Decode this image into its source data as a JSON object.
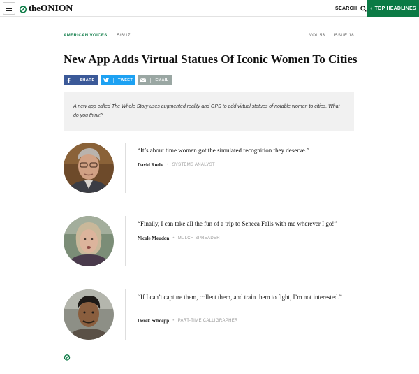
{
  "header": {
    "logo_text_the": "the",
    "logo_text_onion": "ONION",
    "search_label": "SEARCH",
    "top_headlines_label": "TOP HEADLINES"
  },
  "article": {
    "section": "AMERICAN VOICES",
    "date": "5/6/17",
    "volume": "VOL 53",
    "issue": "ISSUE 18",
    "title": "New App Adds Virtual Statues Of Iconic Women To Cities",
    "share": {
      "facebook": "SHARE",
      "twitter": "TWEET",
      "email": "EMAIL"
    },
    "summary": "A new app called The Whole Story uses augmented reality and GPS to add virtual statues of notable women to cities. What do you think?"
  },
  "responses": [
    {
      "quote": "“It’s about time women got the simulated recognition they deserve.”",
      "name": "David Rodie",
      "title": "SYSTEMS ANALYST"
    },
    {
      "quote": "“Finally, I can take all the fun of a trip to Seneca Falls with me wherever I go!”",
      "name": "Nicole Meudon",
      "title": "MULCH SPREADER"
    },
    {
      "quote": "“If I can’t capture them, collect them, and train them to fight, I’m not interested.”",
      "name": "Derek Schoepp",
      "title": "PART-TIME CALLIGRAPHER"
    }
  ],
  "colors": {
    "brand_green": "#0b7a45",
    "facebook": "#3b5998",
    "twitter": "#1da1f2",
    "email": "#9aa7a3"
  },
  "icons": [
    "menu-icon",
    "onion-logo-icon",
    "search-icon",
    "chevron-left-icon",
    "facebook-icon",
    "twitter-icon",
    "email-icon"
  ]
}
